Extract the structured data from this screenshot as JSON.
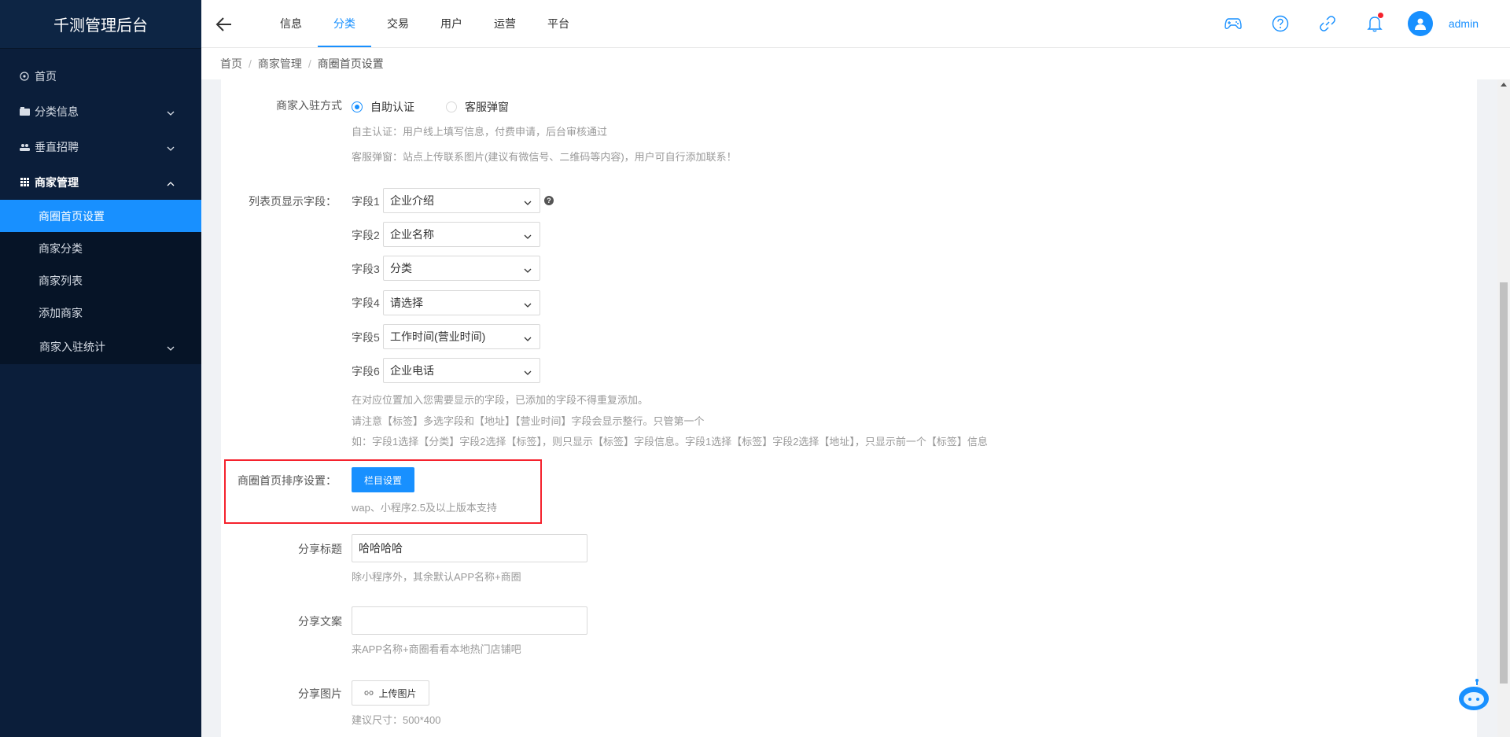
{
  "app": {
    "title": "千测管理后台"
  },
  "sidebar": {
    "items": [
      {
        "label": "首页",
        "icon": "home-icon"
      },
      {
        "label": "分类信息",
        "icon": "folder-icon"
      },
      {
        "label": "垂直招聘",
        "icon": "people-icon"
      },
      {
        "label": "商家管理",
        "icon": "grid-icon"
      }
    ],
    "sub_items": [
      {
        "label": "商圈首页设置"
      },
      {
        "label": "商家分类"
      },
      {
        "label": "商家列表"
      },
      {
        "label": "添加商家"
      },
      {
        "label": "商家入驻统计"
      }
    ]
  },
  "header": {
    "tabs": [
      {
        "label": "信息"
      },
      {
        "label": "分类"
      },
      {
        "label": "交易"
      },
      {
        "label": "用户"
      },
      {
        "label": "运营"
      },
      {
        "label": "平台"
      }
    ],
    "active_tab": "分类",
    "user": "admin"
  },
  "breadcrumb": [
    "首页",
    "商家管理",
    "商圈首页设置"
  ],
  "form": {
    "join_mode": {
      "label": "商家入驻方式",
      "options": [
        "自助认证",
        "客服弹窗"
      ],
      "selected": "自助认证",
      "help1": "自主认证：用户线上填写信息，付费申请，后台审核通过",
      "help2": "客服弹窗：站点上传联系图片(建议有微信号、二维码等内容)，用户可自行添加联系！"
    },
    "list_fields": {
      "label": "列表页显示字段：",
      "fields": [
        {
          "name": "字段1",
          "value": "企业介绍"
        },
        {
          "name": "字段2",
          "value": "企业名称"
        },
        {
          "name": "字段3",
          "value": "分类"
        },
        {
          "name": "字段4",
          "value": "请选择"
        },
        {
          "name": "字段5",
          "value": "工作时间(营业时间)"
        },
        {
          "name": "字段6",
          "value": "企业电话"
        }
      ],
      "help1": "在对应位置加入您需要显示的字段，已添加的字段不得重复添加。",
      "help2": "请注意【标签】多选字段和【地址】【营业时间】字段会显示整行。只管第一个",
      "help3": "如：字段1选择【分类】字段2选择【标签】，则只显示【标签】字段信息。字段1选择【标签】字段2选择【地址】，只显示前一个【标签】信息"
    },
    "sort": {
      "label": "商圈首页排序设置：",
      "button": "栏目设置",
      "help": "wap、小程序2.5及以上版本支持"
    },
    "share_title": {
      "label": "分享标题",
      "value": "哈哈哈哈",
      "help": "除小程序外，其余默认APP名称+商圈"
    },
    "share_text": {
      "label": "分享文案",
      "value": "",
      "help": "来APP名称+商圈看看本地热门店铺吧"
    },
    "share_image": {
      "label": "分享图片",
      "button": "上传图片",
      "help": "建议尺寸：500*400"
    }
  },
  "colors": {
    "accent": "#1890ff",
    "sidebar_bg": "#0b1e3a",
    "highlight": "#f5222d"
  }
}
